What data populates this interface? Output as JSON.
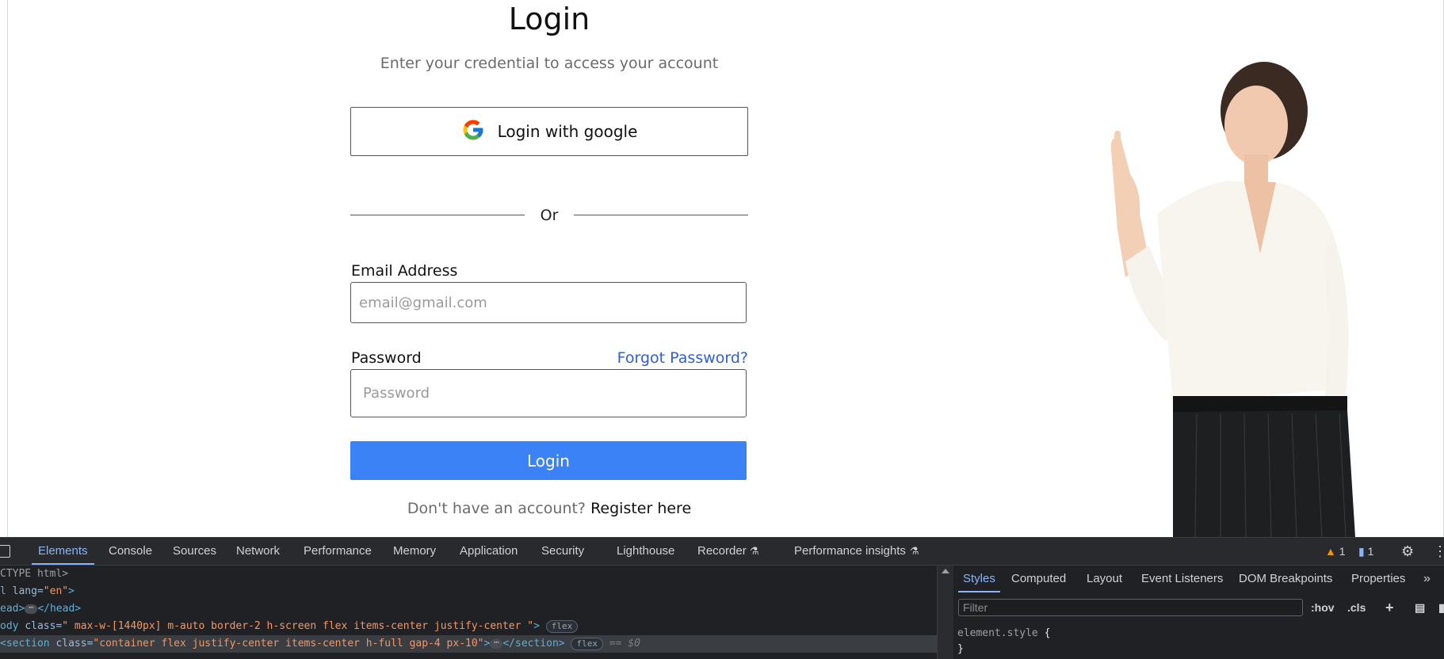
{
  "login": {
    "title": "Login",
    "subtitle": "Enter your credential to access your account",
    "google_button": "Login with google",
    "divider": "Or",
    "email_label": "Email Address",
    "email_placeholder": "email@gmail.com",
    "password_label": "Password",
    "forgot_link": "Forgot Password?",
    "password_placeholder": "Password",
    "login_button": "Login",
    "register_prompt": "Don't have an account?",
    "register_link": "Register here"
  },
  "devtools": {
    "tabs": [
      "Elements",
      "Console",
      "Sources",
      "Network",
      "Performance",
      "Memory",
      "Application",
      "Security",
      "Lighthouse",
      "Recorder",
      "Performance insights"
    ],
    "active_tab": "Elements",
    "warnings_count": "1",
    "messages_count": "1",
    "dom_lines": [
      {
        "text": "CTYPE html>"
      },
      {
        "tag_open": "l",
        "attr": "lang",
        "value": "\"en\"",
        "close": ">"
      },
      {
        "tag_open": "ead>",
        "close": "</head>"
      },
      {
        "tag_open": "ody",
        "attr": "class",
        "value": "\" max-w-[1440px] m-auto border-2 h-screen flex items-center justify-center \"",
        "close": ">",
        "badge": "flex"
      },
      {
        "tag_open": "<section",
        "attr": "class",
        "value": "\"container flex justify-center items-center h-full gap-4 px-10\"",
        "close": "</section>",
        "badge": "flex",
        "eq": "== $0"
      }
    ],
    "styles_tabs": [
      "Styles",
      "Computed",
      "Layout",
      "Event Listeners",
      "DOM Breakpoints",
      "Properties"
    ],
    "styles_active": "Styles",
    "filter_placeholder": "Filter",
    "hov": ":hov",
    "cls": ".cls",
    "element_style": "element.style",
    "open_brace": "{",
    "close_brace": "}"
  },
  "colors": {
    "primary_button": "#3b82f6",
    "link": "#2f5fd6",
    "devtools_bg": "#202124",
    "devtools_accent": "#8ab4f8"
  }
}
